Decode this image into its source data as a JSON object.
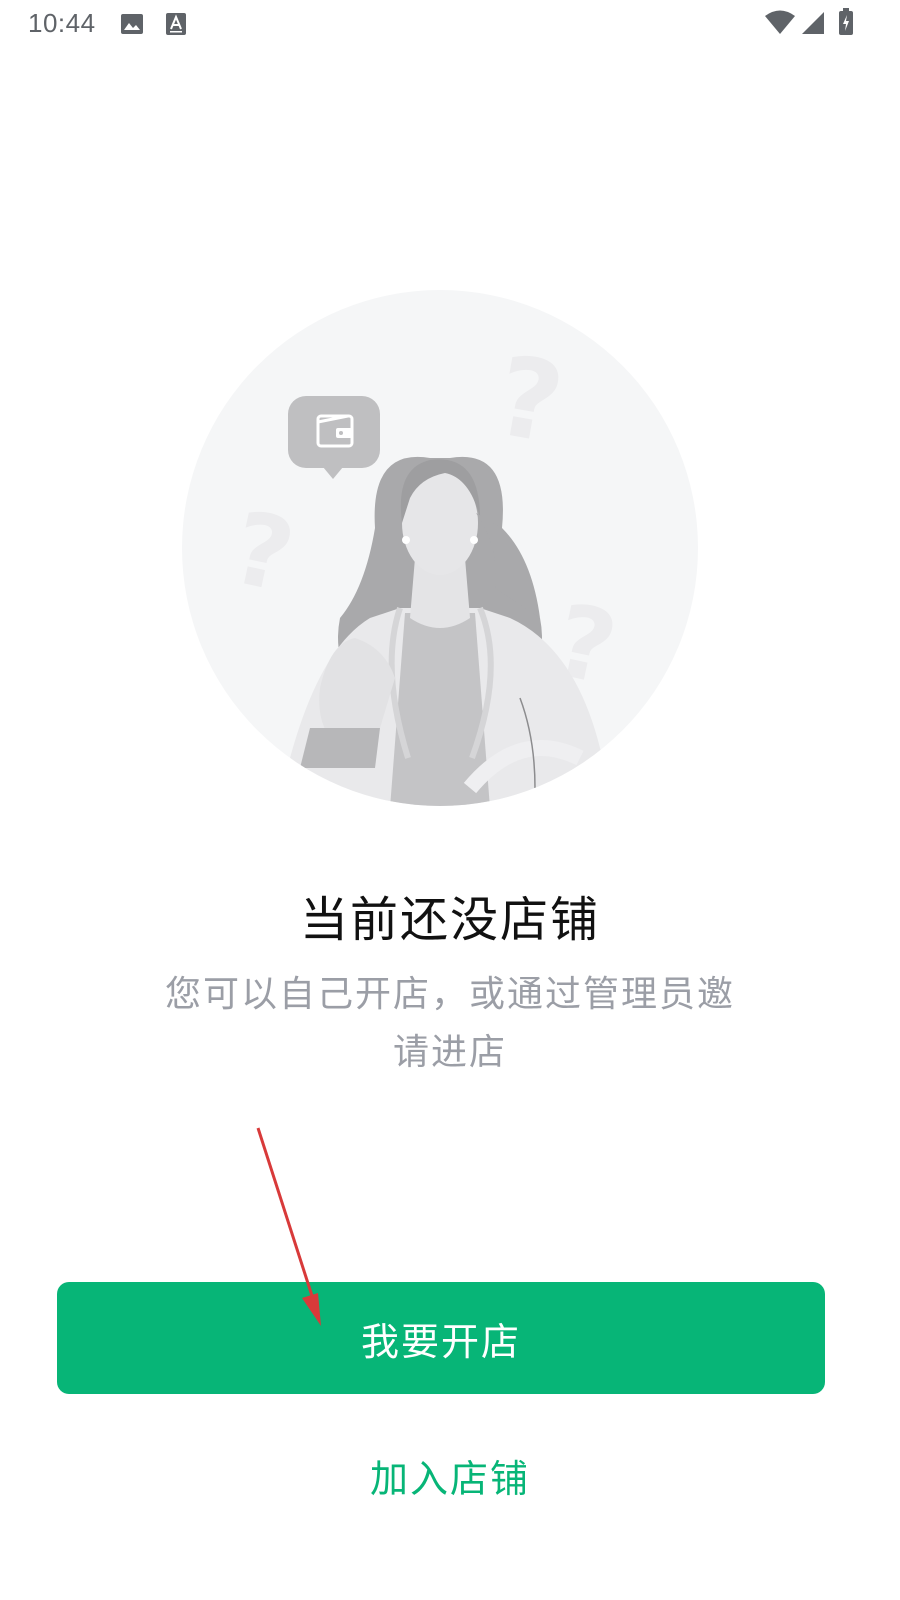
{
  "status_bar": {
    "time": "10:44",
    "left_icons": [
      "image-icon",
      "text-a-icon"
    ],
    "right_icons": [
      "wifi-icon",
      "signal-icon",
      "battery-charging-icon"
    ]
  },
  "empty_state": {
    "illustration": "woman-confused-wallet-illustration",
    "title": "当前还没店铺",
    "description": "您可以自己开店，或通过管理员邀请进店"
  },
  "actions": {
    "open_store_label": "我要开店",
    "join_store_label": "加入店铺"
  },
  "colors": {
    "accent": "#07b577",
    "title": "#111111",
    "description": "#9b9ea6",
    "annotation_arrow": "#d83a3a"
  }
}
